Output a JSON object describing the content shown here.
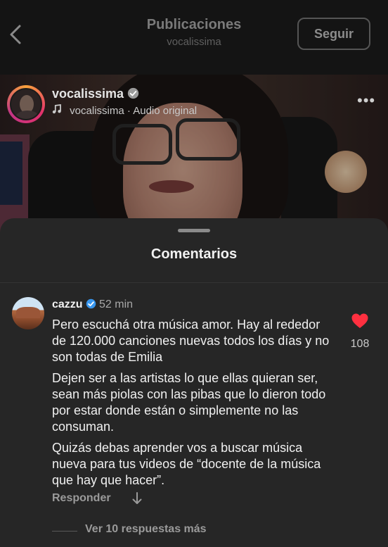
{
  "header": {
    "title": "Publicaciones",
    "subtitle": "vocalissima",
    "follow_label": "Seguir"
  },
  "post": {
    "username": "vocalissima",
    "verified": true,
    "audio_user": "vocalissima",
    "audio_separator": "·",
    "audio_label": "Audio original",
    "more_glyph": "•••"
  },
  "comments_sheet": {
    "title": "Comentarios",
    "comment": {
      "username": "cazzu",
      "verified": true,
      "time": "52 min",
      "paragraphs": [
        "Pero escuchá otra música amor. Hay al rededor de 120.000 canciones nuevas todos los días y no son todas de Emilia",
        "Dejen ser a las artistas lo que ellas quieran ser, sean más piolas con las pibas que lo dieron todo por estar donde están o simplemente no las consuman.",
        "Quizás debas aprender vos a buscar música nueva para tus videos de “docente de la música que hay que hacer”."
      ],
      "likes": "108",
      "liked": true,
      "reply_label": "Responder",
      "view_replies_label": "Ver 10 respuestas más"
    }
  },
  "colors": {
    "verified_blue": "#3897f0",
    "heart_red": "#ff3040",
    "sheet_bg": "#262626"
  },
  "icons": [
    "back-chevron-icon",
    "verified-badge-icon",
    "music-note-icon",
    "more-dots-icon",
    "heart-icon",
    "translate-arrow-icon"
  ]
}
